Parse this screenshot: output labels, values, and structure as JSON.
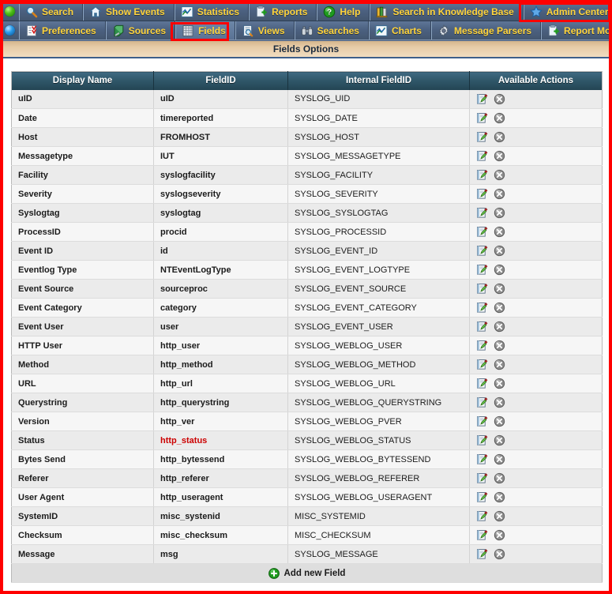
{
  "nav": {
    "row1": {
      "status_orb": "green-orb",
      "items": [
        {
          "label": "Search",
          "icon": "magnifier-icon"
        },
        {
          "label": "Show Events",
          "icon": "home-icon"
        },
        {
          "label": "Statistics",
          "icon": "chart-icon"
        },
        {
          "label": "Reports",
          "icon": "report-icon"
        },
        {
          "label": "Help",
          "icon": "help-icon"
        },
        {
          "label": "Search in Knowledge Base",
          "icon": "books-icon"
        },
        {
          "label": "Admin Center",
          "icon": "star-icon",
          "highlighted": true
        }
      ]
    },
    "row2": {
      "status_orb": "blue-orb",
      "items": [
        {
          "label": "Preferences",
          "icon": "checklist-icon"
        },
        {
          "label": "Sources",
          "icon": "database-icon"
        },
        {
          "label": "Fields",
          "icon": "grid-icon",
          "highlighted": true,
          "active": true
        },
        {
          "label": "Views",
          "icon": "page-search-icon"
        },
        {
          "label": "Searches",
          "icon": "binoculars-icon"
        },
        {
          "label": "Charts",
          "icon": "chart-icon"
        },
        {
          "label": "Message Parsers",
          "icon": "gear-icon"
        },
        {
          "label": "Report Modules",
          "icon": "report-icon"
        }
      ]
    }
  },
  "panel": {
    "title": "Fields Options"
  },
  "table": {
    "columns": [
      "Display Name",
      "FieldID",
      "Internal FieldID",
      "Available Actions"
    ],
    "action_icons": [
      {
        "name": "edit-icon",
        "title": "Edit"
      },
      {
        "name": "delete-icon",
        "title": "Delete"
      }
    ],
    "rows": [
      {
        "display": "uID",
        "fieldid": "uID",
        "internal": "SYSLOG_UID"
      },
      {
        "display": "Date",
        "fieldid": "timereported",
        "internal": "SYSLOG_DATE"
      },
      {
        "display": "Host",
        "fieldid": "FROMHOST",
        "internal": "SYSLOG_HOST"
      },
      {
        "display": "Messagetype",
        "fieldid": "IUT",
        "internal": "SYSLOG_MESSAGETYPE"
      },
      {
        "display": "Facility",
        "fieldid": "syslogfacility",
        "internal": "SYSLOG_FACILITY"
      },
      {
        "display": "Severity",
        "fieldid": "syslogseverity",
        "internal": "SYSLOG_SEVERITY"
      },
      {
        "display": "Syslogtag",
        "fieldid": "syslogtag",
        "internal": "SYSLOG_SYSLOGTAG"
      },
      {
        "display": "ProcessID",
        "fieldid": "procid",
        "internal": "SYSLOG_PROCESSID"
      },
      {
        "display": "Event ID",
        "fieldid": "id",
        "internal": "SYSLOG_EVENT_ID"
      },
      {
        "display": "Eventlog Type",
        "fieldid": "NTEventLogType",
        "internal": "SYSLOG_EVENT_LOGTYPE"
      },
      {
        "display": "Event Source",
        "fieldid": "sourceproc",
        "internal": "SYSLOG_EVENT_SOURCE"
      },
      {
        "display": "Event Category",
        "fieldid": "category",
        "internal": "SYSLOG_EVENT_CATEGORY"
      },
      {
        "display": "Event User",
        "fieldid": "user",
        "internal": "SYSLOG_EVENT_USER"
      },
      {
        "display": "HTTP User",
        "fieldid": "http_user",
        "internal": "SYSLOG_WEBLOG_USER"
      },
      {
        "display": "Method",
        "fieldid": "http_method",
        "internal": "SYSLOG_WEBLOG_METHOD"
      },
      {
        "display": "URL",
        "fieldid": "http_url",
        "internal": "SYSLOG_WEBLOG_URL"
      },
      {
        "display": "Querystring",
        "fieldid": "http_querystring",
        "internal": "SYSLOG_WEBLOG_QUERYSTRING"
      },
      {
        "display": "Version",
        "fieldid": "http_ver",
        "internal": "SYSLOG_WEBLOG_PVER"
      },
      {
        "display": "Status",
        "fieldid": "http_status",
        "internal": "SYSLOG_WEBLOG_STATUS",
        "fieldid_alert": true
      },
      {
        "display": "Bytes Send",
        "fieldid": "http_bytessend",
        "internal": "SYSLOG_WEBLOG_BYTESSEND"
      },
      {
        "display": "Referer",
        "fieldid": "http_referer",
        "internal": "SYSLOG_WEBLOG_REFERER"
      },
      {
        "display": "User Agent",
        "fieldid": "http_useragent",
        "internal": "SYSLOG_WEBLOG_USERAGENT"
      },
      {
        "display": "SystemID",
        "fieldid": "misc_systenid",
        "internal": "MISC_SYSTEMID"
      },
      {
        "display": "Checksum",
        "fieldid": "misc_checksum",
        "internal": "MISC_CHECKSUM"
      },
      {
        "display": "Message",
        "fieldid": "msg",
        "internal": "SYSLOG_MESSAGE"
      }
    ],
    "footer": {
      "add_label": "Add new Field",
      "add_icon": "plus-circle-icon"
    }
  },
  "colors": {
    "highlight_box": "#ff0000",
    "nav_label": "#ffd43b",
    "nav_bg": "#4c6181",
    "panel_title_bg": "#e6cba6",
    "table_header_bg": "#2f5668",
    "alert_text": "#cc0000",
    "add_icon_green": "#16a018"
  }
}
